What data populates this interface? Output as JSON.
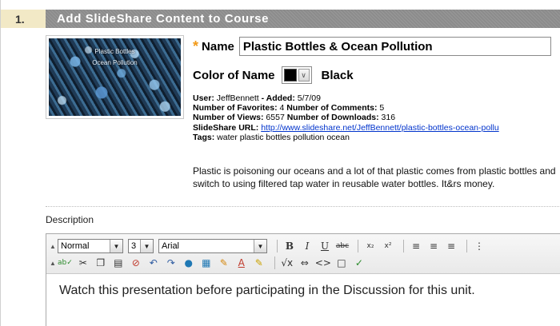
{
  "step": {
    "number": "1.",
    "title": "Add SlideShare Content to Course"
  },
  "thumbnail": {
    "line1": "Plastic Bottles",
    "line2": "Ocean Pollution"
  },
  "name_field": {
    "label": "Name",
    "value": "Plastic Bottles & Ocean Pollution",
    "required_marker": "*"
  },
  "color_field": {
    "label": "Color of Name",
    "value": "Black",
    "swatch_color": "#000000"
  },
  "meta": {
    "user_label": "User:",
    "user_value": "JeffBennett",
    "added_label": "- Added:",
    "added_value": "5/7/09",
    "favorites_label": "Number of Favorites:",
    "favorites_value": "4",
    "comments_label": "Number of Comments:",
    "comments_value": "5",
    "views_label": "Number of Views:",
    "views_value": "6557",
    "downloads_label": "Number of Downloads:",
    "downloads_value": "316",
    "url_label": "SlideShare URL:",
    "url_value": "http://www.slideshare.net/JeffBennett/plastic-bottles-ocean-pollu",
    "tags_label": "Tags:",
    "tags_value": "water plastic bottles pollution ocean"
  },
  "summary": "Plastic is poisoning our oceans and a lot of that plastic comes from plastic bottles and switch to using filtered tap water in reusable water bottles. It&rs money.",
  "description_label": "Description",
  "editor": {
    "style_select": "Normal",
    "size_select": "3",
    "font_select": "Arial",
    "content": "Watch this presentation before participating in the Discussion for this unit."
  }
}
